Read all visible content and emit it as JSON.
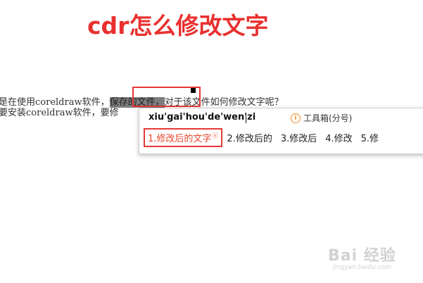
{
  "page": {
    "title": "cdr怎么修改文字"
  },
  "document": {
    "line1_before": "是在使用coreldraw软件，",
    "line1_selected": "保存的文件，",
    "line1_after": "对于该文件如何修改文字呢？",
    "line2": "要安装coreldraw软件，要修"
  },
  "ime": {
    "pinyin": "xiu'gai'hou'de'wen'zi",
    "toolbox_label": "工具箱(分号)",
    "candidates": [
      {
        "label": "1.修改后的文字"
      },
      {
        "label": "2.修改后的"
      },
      {
        "label": "3.修改后"
      },
      {
        "label": "4.修改"
      },
      {
        "label": "5.修"
      }
    ]
  },
  "watermark": {
    "brand": "Bai 经验",
    "url": "jingyan.baidu.com"
  },
  "colors": {
    "title": "#e8312f",
    "highlight_box": "#e53935",
    "selection": "#7d7d7d"
  }
}
